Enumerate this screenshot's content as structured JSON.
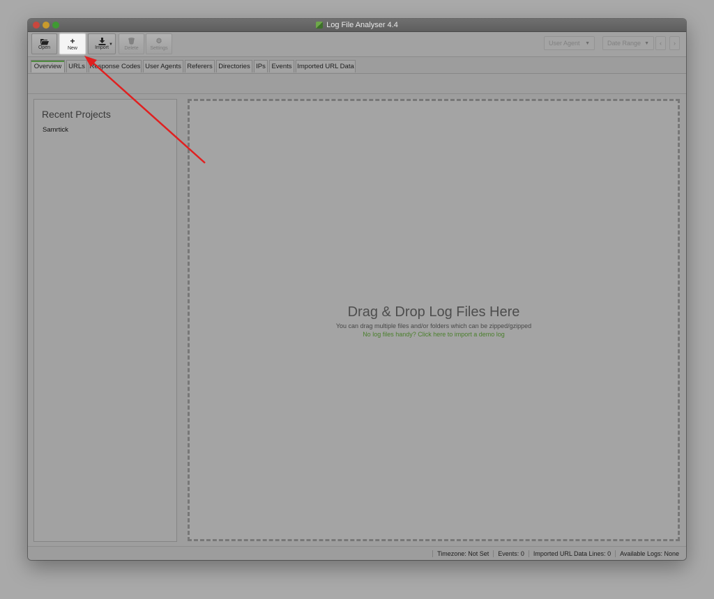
{
  "window": {
    "title": "Log File Analyser 4.4"
  },
  "toolbar": {
    "open_label": "Open",
    "new_label": "New",
    "import_label": "Import",
    "delete_label": "Delete",
    "settings_label": "Settings",
    "user_agent_value": "User Agent",
    "date_range_value": "Date Range"
  },
  "tabs": [
    {
      "label": "Overview"
    },
    {
      "label": "URLs"
    },
    {
      "label": "Response Codes"
    },
    {
      "label": "User Agents"
    },
    {
      "label": "Referers"
    },
    {
      "label": "Directories"
    },
    {
      "label": "IPs"
    },
    {
      "label": "Events"
    },
    {
      "label": "Imported URL Data"
    }
  ],
  "recent_projects": {
    "title": "Recent Projects",
    "items": [
      {
        "label": "Samrtick"
      }
    ]
  },
  "dropzone": {
    "title": "Drag & Drop Log Files Here",
    "subtitle": "You can drag multiple files and/or folders which can be zipped/gzipped",
    "demo_link": "No log files handy? Click here to import a demo log"
  },
  "status": {
    "timezone_label": "Timezone:",
    "timezone_value": "Not Set",
    "events_label": "Events:",
    "events_value": "0",
    "imported_label": "Imported URL Data Lines:",
    "imported_value": "0",
    "logs_label": "Available Logs:",
    "logs_value": "None"
  },
  "colors": {
    "accent_green": "#4a7f2c",
    "annotation_arrow": "#e02020"
  }
}
